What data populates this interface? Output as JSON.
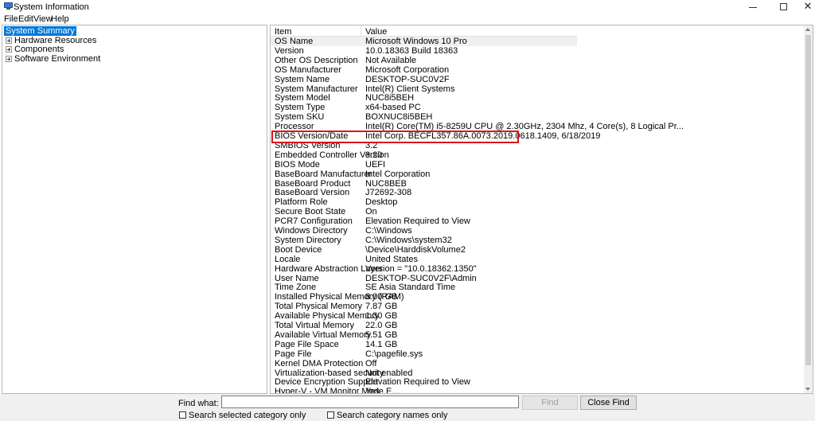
{
  "window": {
    "title": "System Information",
    "controls": {
      "minimize": "—",
      "maximize": "□",
      "close": "✕"
    }
  },
  "menu": [
    "File",
    "Edit",
    "View",
    "Help"
  ],
  "tree": [
    {
      "label": "System Summary",
      "selected": true,
      "expandable": false
    },
    {
      "label": "Hardware Resources",
      "selected": false,
      "expandable": true
    },
    {
      "label": "Components",
      "selected": false,
      "expandable": true
    },
    {
      "label": "Software Environment",
      "selected": false,
      "expandable": true
    }
  ],
  "table": {
    "columns": {
      "item": "Item",
      "value": "Value"
    },
    "rows": [
      {
        "item": "OS Name",
        "value": "Microsoft Windows 10 Pro"
      },
      {
        "item": "Version",
        "value": "10.0.18363 Build 18363"
      },
      {
        "item": "Other OS Description",
        "value": "Not Available"
      },
      {
        "item": "OS Manufacturer",
        "value": "Microsoft Corporation"
      },
      {
        "item": "System Name",
        "value": "DESKTOP-SUC0V2F"
      },
      {
        "item": "System Manufacturer",
        "value": "Intel(R) Client Systems"
      },
      {
        "item": "System Model",
        "value": "NUC8i5BEH"
      },
      {
        "item": "System Type",
        "value": "x64-based PC"
      },
      {
        "item": "System SKU",
        "value": "BOXNUC8i5BEH"
      },
      {
        "item": "Processor",
        "value": "Intel(R) Core(TM) i5-8259U CPU @ 2.30GHz, 2304 Mhz, 4 Core(s), 8 Logical Pr..."
      },
      {
        "item": "BIOS Version/Date",
        "value": "Intel Corp. BECFL357.86A.0073.2019.0618.1409, 6/18/2019"
      },
      {
        "item": "SMBIOS Version",
        "value": "3.2"
      },
      {
        "item": "Embedded Controller Version",
        "value": "3.20"
      },
      {
        "item": "BIOS Mode",
        "value": "UEFI"
      },
      {
        "item": "BaseBoard Manufacturer",
        "value": "Intel Corporation"
      },
      {
        "item": "BaseBoard Product",
        "value": "NUC8BEB"
      },
      {
        "item": "BaseBoard Version",
        "value": "J72692-308"
      },
      {
        "item": "Platform Role",
        "value": "Desktop"
      },
      {
        "item": "Secure Boot State",
        "value": "On"
      },
      {
        "item": "PCR7 Configuration",
        "value": "Elevation Required to View"
      },
      {
        "item": "Windows Directory",
        "value": "C:\\Windows"
      },
      {
        "item": "System Directory",
        "value": "C:\\Windows\\system32"
      },
      {
        "item": "Boot Device",
        "value": "\\Device\\HarddiskVolume2"
      },
      {
        "item": "Locale",
        "value": "United States"
      },
      {
        "item": "Hardware Abstraction Layer",
        "value": "Version = \"10.0.18362.1350\""
      },
      {
        "item": "User Name",
        "value": "DESKTOP-SUC0V2F\\Admin"
      },
      {
        "item": "Time Zone",
        "value": "SE Asia Standard Time"
      },
      {
        "item": "Installed Physical Memory (RAM)",
        "value": "8.00 GB"
      },
      {
        "item": "Total Physical Memory",
        "value": "7.87 GB"
      },
      {
        "item": "Available Physical Memory",
        "value": "1.30 GB"
      },
      {
        "item": "Total Virtual Memory",
        "value": "22.0 GB"
      },
      {
        "item": "Available Virtual Memory",
        "value": "5.51 GB"
      },
      {
        "item": "Page File Space",
        "value": "14.1 GB"
      },
      {
        "item": "Page File",
        "value": "C:\\pagefile.sys"
      },
      {
        "item": "Kernel DMA Protection",
        "value": "Off"
      },
      {
        "item": "Virtualization-based security",
        "value": "Not enabled"
      },
      {
        "item": "Device Encryption Support",
        "value": "Elevation Required to View"
      },
      {
        "item": "Hyper-V - VM Monitor Mode E...",
        "value": "Yes"
      }
    ],
    "highlighted_item": "BIOS Version/Date"
  },
  "find": {
    "label": "Find what:",
    "value": "",
    "find_button": "Find",
    "close_button": "Close Find",
    "search_selected_category": "Search selected category only",
    "search_category_names": "Search category names only"
  },
  "colors": {
    "selection": "#0078d7",
    "highlight_border": "#d7161c",
    "panel_background": "#f0f0f0"
  }
}
